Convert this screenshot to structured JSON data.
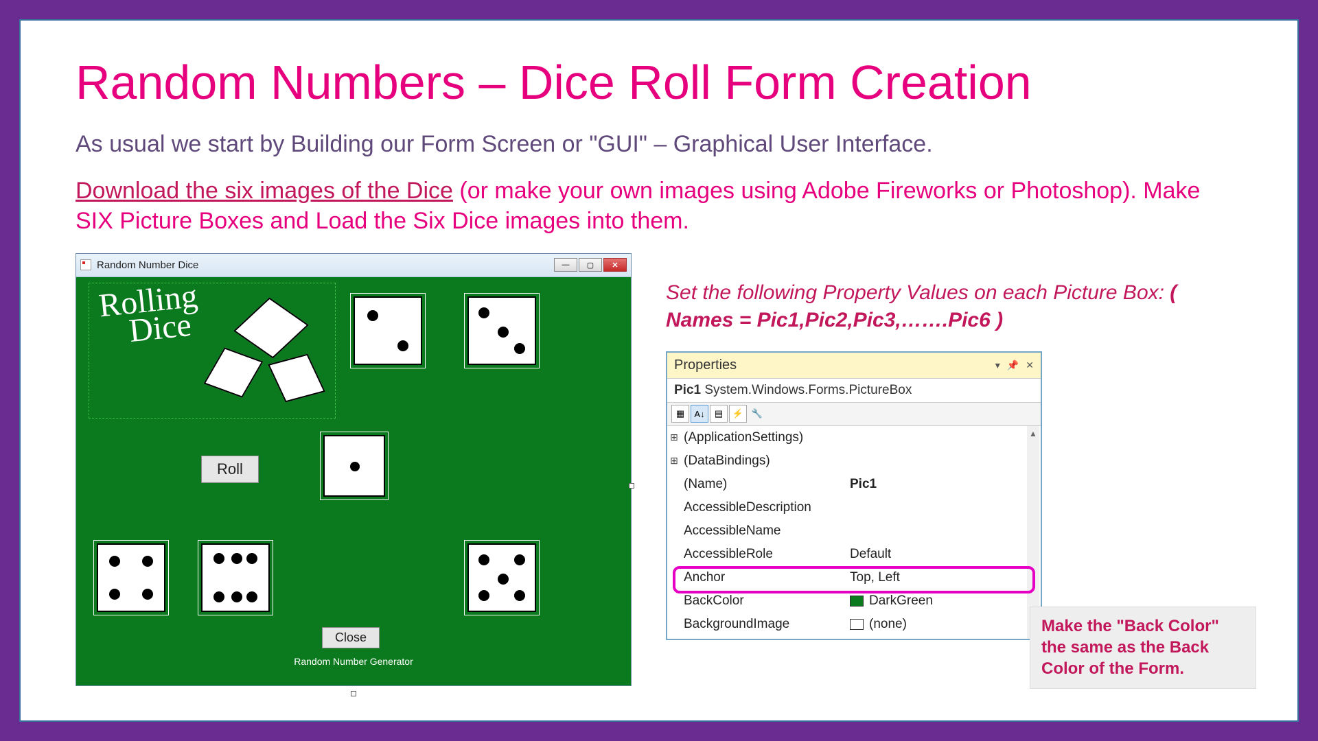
{
  "title": "Random Numbers – Dice Roll Form Creation",
  "intro": "As usual we start by Building our Form Screen or \"GUI\" – Graphical User Interface.",
  "download_link_text": "Download the six images of the Dice",
  "download_rest": " (or make your own images using Adobe Fireworks or Photoshop). Make SIX Picture Boxes and Load the Six Dice images into them.",
  "form": {
    "title": "Random Number Dice",
    "logo_line1": "Rolling",
    "logo_line2": "Dice",
    "roll_label": "Roll",
    "close_label": "Close",
    "footer": "Random Number Generator"
  },
  "instr_line": "Set the following Property Values on each Picture Box:  ",
  "instr_bold": "( Names = Pic1,Pic2,Pic3,…….Pic6 )",
  "props": {
    "panel_title": "Properties",
    "selected_name": "Pic1",
    "selected_type": "System.Windows.Forms.PictureBox",
    "rows": {
      "app": "(ApplicationSettings)",
      "db": "(DataBindings)",
      "name_label": "(Name)",
      "name_value": "Pic1",
      "ad": "AccessibleDescription",
      "an": "AccessibleName",
      "ar_label": "AccessibleRole",
      "ar_value": "Default",
      "anchor_label": "Anchor",
      "anchor_value": "Top, Left",
      "bc_label": "BackColor",
      "bc_value": "DarkGreen",
      "bi_label": "BackgroundImage",
      "bi_value": "(none)"
    }
  },
  "callout": "Make the \"Back Color\" the same as the Back Color of the Form."
}
